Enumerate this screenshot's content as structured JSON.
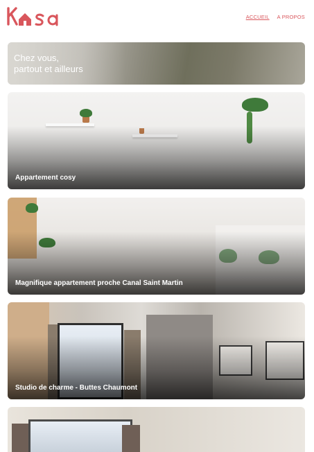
{
  "brand": {
    "logo_text": "Kasa",
    "accent": "#d9565c"
  },
  "nav": {
    "items": [
      {
        "label": "ACCUEIL",
        "active": true
      },
      {
        "label": "A PROPOS",
        "active": false
      }
    ]
  },
  "hero": {
    "line1": "Chez vous,",
    "line2": "partout et ailleurs"
  },
  "listings": [
    {
      "title": "Appartement cosy"
    },
    {
      "title": "Magnifique appartement proche Canal Saint Martin"
    },
    {
      "title": "Studio de charme - Buttes Chaumont"
    },
    {
      "title": ""
    }
  ]
}
